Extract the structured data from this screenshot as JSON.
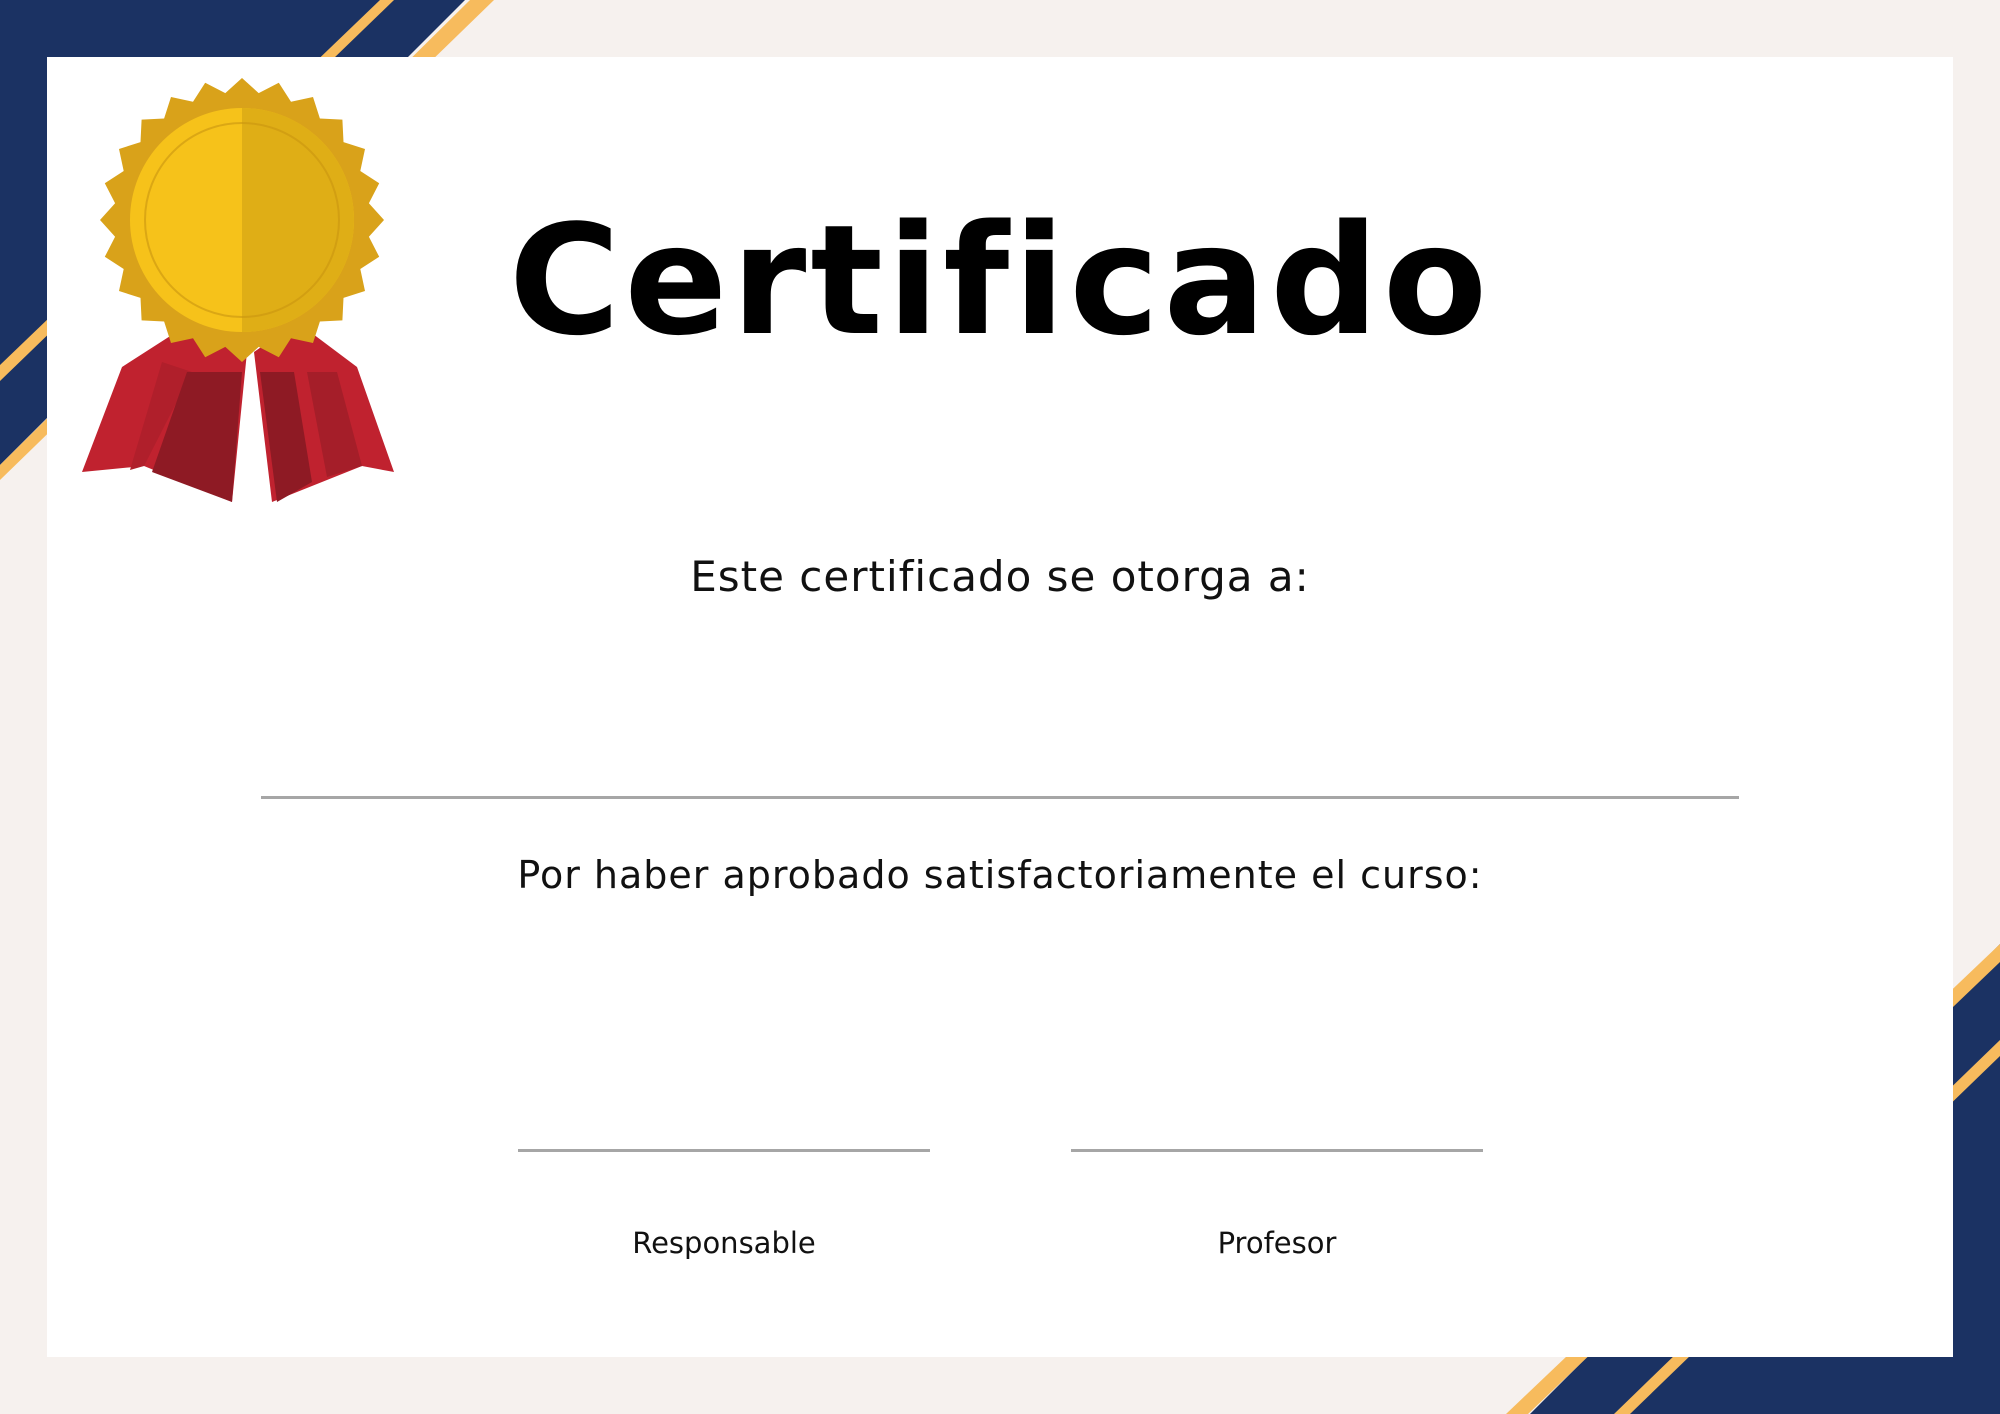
{
  "certificate": {
    "title": "Certificado",
    "awarded_to_text": "Este certificado se otorga a:",
    "course_text": "Por haber aprobado satisfactoriamente el curso:",
    "signatures": [
      {
        "label": "Responsable"
      },
      {
        "label": "Profesor"
      }
    ]
  },
  "colors": {
    "navy": "#1b3263",
    "gold_stripe": "#f7bb5d",
    "background": "#f6f1ee",
    "card": "#ffffff",
    "medal_gold": "#f6c21a",
    "ribbon_red": "#c0222f"
  }
}
